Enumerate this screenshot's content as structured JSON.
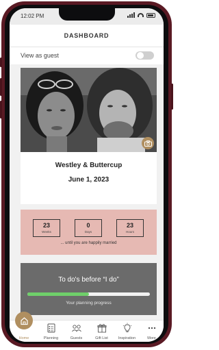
{
  "status_bar": {
    "time": "12:02 PM"
  },
  "header": {
    "title": "DASHBOARD"
  },
  "guest_view": {
    "label": "View as guest",
    "enabled": false
  },
  "couple": {
    "names": "Westley & Buttercup",
    "date": "June 1, 2023"
  },
  "countdown": {
    "units": [
      {
        "value": "23",
        "label": "Weeks"
      },
      {
        "value": "0",
        "label": "Days"
      },
      {
        "value": "23",
        "label": "Hours"
      }
    ],
    "caption": "... until you are happily married"
  },
  "todo": {
    "title": "To do's before “I do”",
    "progress_caption": "Your planning progress",
    "progress_fraction": 0.5
  },
  "tabs": [
    {
      "label": "Home",
      "icon": "home-icon",
      "active": true
    },
    {
      "label": "Planning",
      "icon": "checklist-icon"
    },
    {
      "label": "Guests",
      "icon": "guests-icon"
    },
    {
      "label": "Gift List",
      "icon": "gift-icon"
    },
    {
      "label": "Inspiration",
      "icon": "lightbulb-icon"
    },
    {
      "label": "More",
      "icon": "more-icon"
    }
  ],
  "colors": {
    "accent": "#b08f60",
    "countdown_bg": "#e6b9b3",
    "todo_bg": "#6b6b6b",
    "progress": "#6fcf6a",
    "frame": "#5a1a24"
  }
}
